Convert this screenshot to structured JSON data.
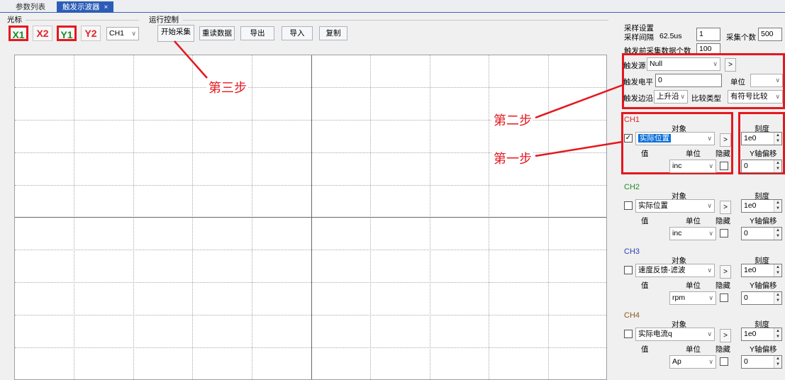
{
  "tabs": [
    {
      "label": "参数列表",
      "active": false
    },
    {
      "label": "触发示波器",
      "active": true,
      "close": "×"
    }
  ],
  "cursor": {
    "group_title": "光标",
    "buttons": [
      {
        "label": "X1",
        "color": "green",
        "highlighted": true
      },
      {
        "label": "X2",
        "color": "red",
        "highlighted": false
      },
      {
        "label": "Y1",
        "color": "green",
        "highlighted": true
      },
      {
        "label": "Y2",
        "color": "red",
        "highlighted": false
      }
    ],
    "channel_select": "CH1"
  },
  "run_control": {
    "group_title": "运行控制",
    "buttons": [
      "开始采集",
      "重读数据",
      "导出",
      "导入",
      "复制"
    ]
  },
  "sampling": {
    "group_title": "采样设置",
    "interval_label": "采样间隔",
    "interval_value": "62.5us",
    "interval_input": "1",
    "count_label": "采集个数",
    "count_value": "500",
    "pretrigger_label": "触发前采集数据个数",
    "pretrigger_value": "100"
  },
  "trigger": {
    "source_label": "触发源",
    "source_value": "Null",
    "more_button": ">",
    "level_label": "触发电平",
    "level_value": "0",
    "unit_label": "单位",
    "unit_value": "",
    "edge_label": "触发边沿",
    "edge_value": "上升沿",
    "compare_label": "比较类型",
    "compare_value": "有符号比较"
  },
  "channel_common": {
    "object_label": "对象",
    "scale_label": "刻度",
    "value_label": "值",
    "unit_label": "单位",
    "hide_label": "隐藏",
    "offset_label": "Y轴偏移",
    "more_button": ">"
  },
  "channels": [
    {
      "name": "CH1",
      "color": "#e0242b",
      "checked": "✓",
      "object": "实际位置",
      "scale": "1e0",
      "unit": "inc",
      "offset": "0"
    },
    {
      "name": "CH2",
      "color": "#1f8a2c",
      "checked": "",
      "object": "实际位置",
      "scale": "1e0",
      "unit": "inc",
      "offset": "0"
    },
    {
      "name": "CH3",
      "color": "#2b3fb7",
      "checked": "",
      "object": "速度反馈-滤波",
      "scale": "1e0",
      "unit": "rpm",
      "offset": "0"
    },
    {
      "name": "CH4",
      "color": "#8a5a1a",
      "checked": "",
      "object": "实际电流q",
      "scale": "1e0",
      "unit": "Ap",
      "offset": "0"
    }
  ],
  "annotations": {
    "step1": "第一步",
    "step2": "第二步",
    "step3": "第三步"
  },
  "icons": {
    "dropdown": "chevron-down-icon",
    "spinner": "spinner-icon",
    "close": "close-icon"
  }
}
